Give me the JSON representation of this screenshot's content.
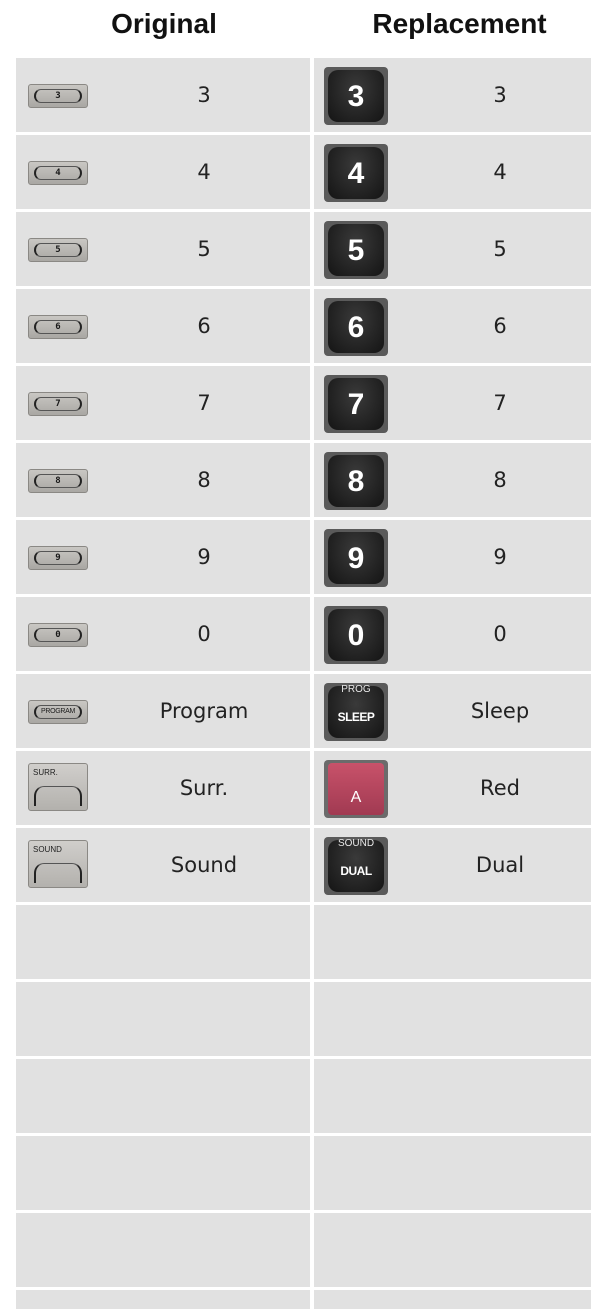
{
  "header": {
    "original": "Original",
    "replacement": "Replacement"
  },
  "rows": [
    {
      "orig_key": "3",
      "orig_label": "3",
      "repl_key": "3",
      "repl_label": "3"
    },
    {
      "orig_key": "4",
      "orig_label": "4",
      "repl_key": "4",
      "repl_label": "4"
    },
    {
      "orig_key": "5",
      "orig_label": "5",
      "repl_key": "5",
      "repl_label": "5"
    },
    {
      "orig_key": "6",
      "orig_label": "6",
      "repl_key": "6",
      "repl_label": "6"
    },
    {
      "orig_key": "7",
      "orig_label": "7",
      "repl_key": "7",
      "repl_label": "7"
    },
    {
      "orig_key": "8",
      "orig_label": "8",
      "repl_key": "8",
      "repl_label": "8"
    },
    {
      "orig_key": "9",
      "orig_label": "9",
      "repl_key": "9",
      "repl_label": "9"
    },
    {
      "orig_key": "0",
      "orig_label": "0",
      "repl_key": "0",
      "repl_label": "0"
    },
    {
      "orig_key": "PROGRAM",
      "orig_label": "Program",
      "repl_caption": "PROG",
      "repl_key": "SLEEP",
      "repl_label": "Sleep"
    },
    {
      "orig_caption": "SURR.",
      "orig_label": "Surr.",
      "repl_key": "A",
      "repl_label": "Red"
    },
    {
      "orig_caption": "SOUND",
      "orig_label": "Sound",
      "repl_caption": "SOUND",
      "repl_key": "DUAL",
      "repl_label": "Dual"
    }
  ]
}
